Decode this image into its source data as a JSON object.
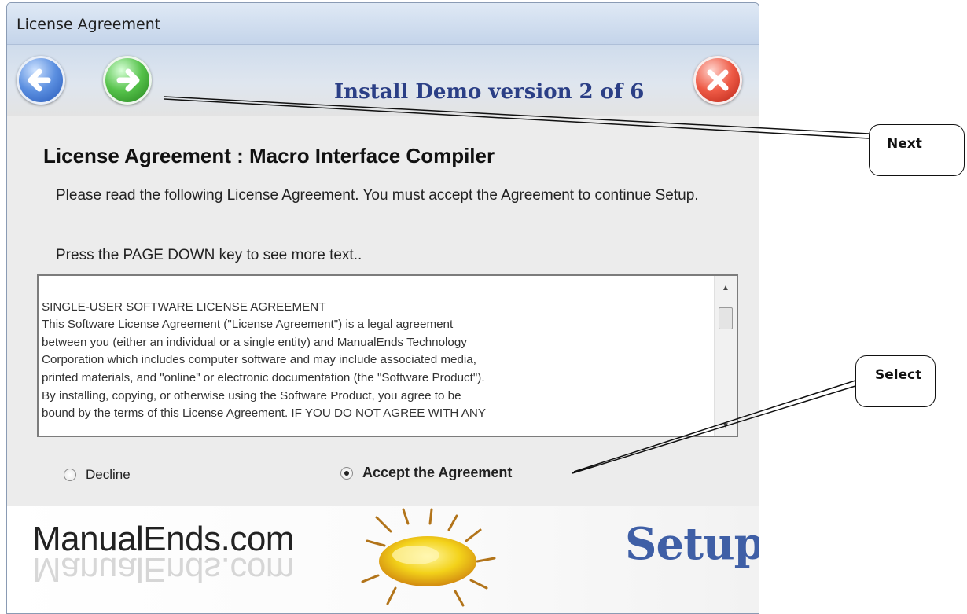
{
  "window": {
    "title": "License Agreement"
  },
  "toolbar": {
    "step_title": "Install Demo version 2 of 6",
    "back_icon": "back-arrow-icon",
    "next_icon": "next-arrow-icon",
    "close_icon": "close-x-icon",
    "colors": {
      "back": "#2f62c8",
      "next": "#3aa52f",
      "close": "#d83a28",
      "title": "#2b3f86"
    }
  },
  "content": {
    "heading": "License Agreement :  Macro Interface Compiler",
    "instruction": "Please read the following License Agreement.  You must accept the Agreement to continue Setup.",
    "hint": "Press the PAGE DOWN key to see more text.."
  },
  "license": {
    "lines": [
      "SINGLE-USER SOFTWARE LICENSE AGREEMENT",
      "This Software License Agreement (\"License Agreement\") is a legal agreement",
      "between you (either an individual or a single entity) and ManualEnds Technology",
      "Corporation which includes computer software and may include associated media,",
      "printed materials, and \"online\" or electronic documentation (the \"Software Product\").",
      "By installing, copying, or otherwise using the Software Product, you agree to be",
      "bound by the terms of this License Agreement. IF YOU DO NOT AGREE WITH ANY"
    ]
  },
  "options": {
    "decline_label": "Decline",
    "accept_label": "Accept the Agreement",
    "selected": "accept"
  },
  "banner": {
    "brand": "ManualEnds.com",
    "setup": "Setup"
  },
  "callouts": {
    "next": "Next",
    "select": "Select"
  }
}
